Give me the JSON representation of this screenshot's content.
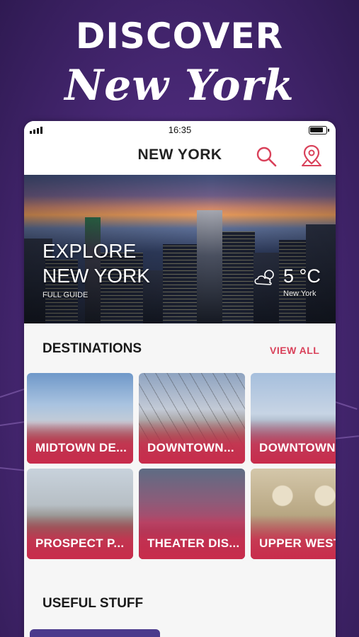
{
  "promo": {
    "title": "DISCOVER",
    "subtitle": "New York"
  },
  "statusbar": {
    "time": "16:35"
  },
  "navbar": {
    "title": "NEW YORK",
    "icons": [
      "search-icon",
      "map-pin-icon"
    ]
  },
  "hero": {
    "title_line1": "EXPLORE",
    "title_line2": "NEW YORK",
    "guide": "FULL GUIDE",
    "temperature": "5 °C",
    "city": "New York",
    "weather_icon": "partly-cloudy-icon"
  },
  "destinations": {
    "heading": "DESTINATIONS",
    "view_all": "VIEW ALL",
    "items": [
      {
        "label": "MIDTOWN DE..."
      },
      {
        "label": "DOWNTOWN..."
      },
      {
        "label": "DOWNTOWN"
      },
      {
        "label": "PROSPECT P..."
      },
      {
        "label": "THEATER DIS..."
      },
      {
        "label": "UPPER WEST"
      }
    ]
  },
  "useful": {
    "heading": "USEFUL STUFF"
  },
  "colors": {
    "accent": "#d9415a",
    "card_overlay": "#c92c4c",
    "background": "#5b3488",
    "tab": "#4b3a8c"
  }
}
